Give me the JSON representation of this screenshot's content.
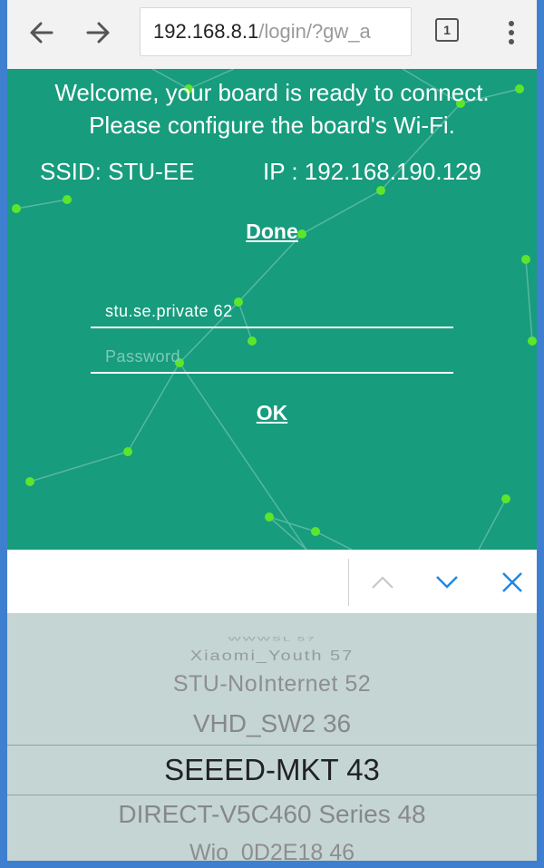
{
  "browser": {
    "url_host": "192.168.8.1",
    "url_path": "/login/?gw_a",
    "tab_count": "1",
    "icons": [
      "back-arrow-icon",
      "forward-arrow-icon",
      "tab-switcher-icon",
      "more-vert-icon"
    ]
  },
  "page": {
    "background": "#179c7d",
    "welcome_line1": "Welcome, your board is ready to connect.",
    "welcome_line2": "Please configure the board's Wi-Fi.",
    "ssid_label": "SSID: STU-EE",
    "ip_label": "IP : 192.168.190.129",
    "done_link": "Done",
    "ssid_field_value": "stu.se.private 62",
    "password_placeholder": "Password",
    "ok_link": "OK"
  },
  "picker_bar": {
    "accent": "#1e88e5",
    "icons": [
      "chevron-up-icon",
      "chevron-down-icon",
      "close-icon"
    ]
  },
  "picker": {
    "items": [
      "WWWSL 57",
      "Xiaomi_Youth 57",
      "STU-NoInternet 52",
      "VHD_SW2 36",
      "SEEED-MKT 43",
      "DIRECT-V5C460 Series 48",
      "Wio_0D2E18 46"
    ],
    "selected": "SEEED-MKT 43"
  }
}
